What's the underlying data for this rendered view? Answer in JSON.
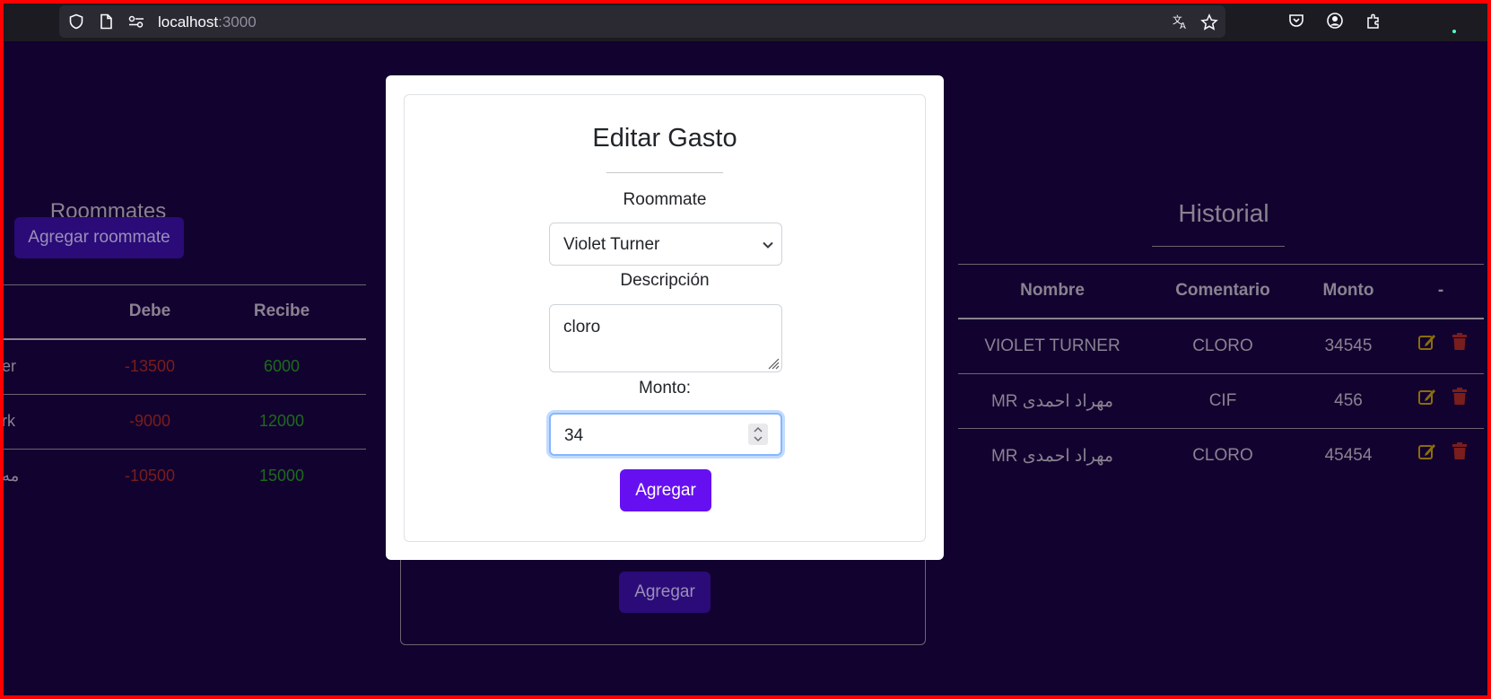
{
  "browser": {
    "url_host": "localhost",
    "url_port": ":3000"
  },
  "roommates_panel": {
    "title": "Roommates",
    "add_button": "Agregar roommate",
    "columns": [
      "Debe",
      "Recibe"
    ],
    "rows": [
      {
        "name": "er",
        "debe": "-13500",
        "recibe": "6000"
      },
      {
        "name": "rk",
        "debe": "-9000",
        "recibe": "12000"
      },
      {
        "name": "مه",
        "debe": "-10500",
        "recibe": "15000"
      }
    ]
  },
  "background_form": {
    "submit_label": "Agregar"
  },
  "history_panel": {
    "title": "Historial",
    "columns": [
      "Nombre",
      "Comentario",
      "Monto",
      "-"
    ],
    "rows": [
      {
        "nombre": "VIOLET TURNER",
        "comentario": "CLORO",
        "monto": "34545"
      },
      {
        "nombre": "MR مهراد احمدی",
        "comentario": "CIF",
        "monto": "456"
      },
      {
        "nombre": "MR مهراد احمدی",
        "comentario": "CLORO",
        "monto": "45454"
      }
    ],
    "colors": {
      "edit": "#8a6d0b",
      "delete": "#7a1d1d"
    }
  },
  "modal": {
    "title": "Editar Gasto",
    "roommate_label": "Roommate",
    "roommate_value": "Violet Turner",
    "description_label": "Descripción",
    "description_value": "cloro",
    "amount_label": "Monto:",
    "amount_value": "34",
    "submit_label": "Agregar",
    "accent": "#6610f2"
  }
}
